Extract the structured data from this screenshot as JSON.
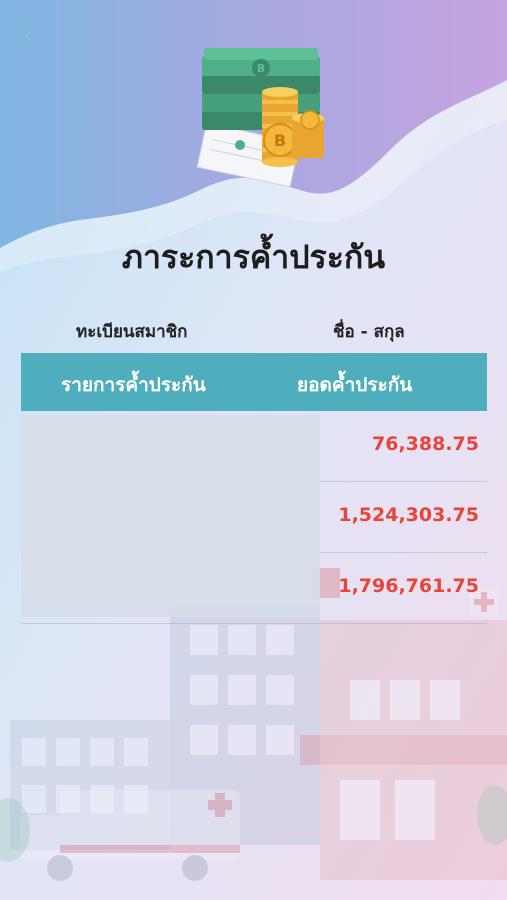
{
  "header": {
    "back_icon": "chevron-left-icon",
    "illustration": "money-and-bitcoin-coins-illustration"
  },
  "page": {
    "title": "ภาระการค้ำประกัน",
    "member_id_label": "ทะเบียนสมาชิก",
    "member_name_label": "ชื่อ - สกุล"
  },
  "table": {
    "header_left": "รายการค้ำประกัน",
    "header_right": "ยอดค้ำประกัน",
    "header_color": "#4eaebe",
    "amount_color": "#e8443a",
    "rows": [
      {
        "amount": "76,388.75"
      },
      {
        "amount": "1,524,303.75"
      },
      {
        "amount": "1,796,761.75"
      }
    ]
  }
}
